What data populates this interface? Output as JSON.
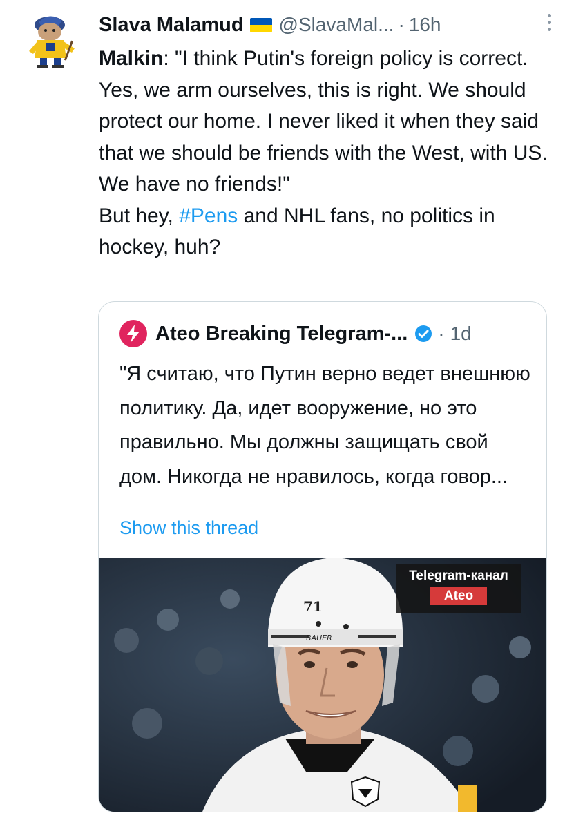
{
  "tweet": {
    "author_name": "Slava Malamud",
    "author_flag": "ukraine-flag-icon",
    "handle": "@SlavaMal...",
    "separator": "·",
    "time": "16h",
    "text": {
      "speaker": "Malkin",
      "quote": ": \"I think Putin's foreign policy is correct. Yes, we arm ourselves, this is right. We should protect our home. I never liked it when they said that we should be friends with the West, with US. We have no friends!\"",
      "comment_start": "But hey, ",
      "hashtag": "#Pens",
      "comment_end": " and NHL fans, no politics in hockey, huh?"
    }
  },
  "quoted_tweet": {
    "author_name": "Ateo Breaking Telegram-...",
    "verified_icon": "verified-badge-icon",
    "separator": "·",
    "time": "1d",
    "text": "\"Я считаю, что Путин верно ведет внешнюю политику. Да, идет вооружение, но это правильно. Мы должны защищать свой дом. Никогда не нравилось, когда говор...",
    "show_thread": "Show this thread",
    "image": {
      "helmet_number": "71",
      "helmet_brand": "BAUER",
      "watermark_line1": "Telegram-канал",
      "watermark_line2": "Ateo"
    }
  },
  "colors": {
    "link": "#1d9bf0",
    "secondary_text": "#536471",
    "border": "#cfd9de",
    "quoted_avatar": "#e0245e"
  }
}
